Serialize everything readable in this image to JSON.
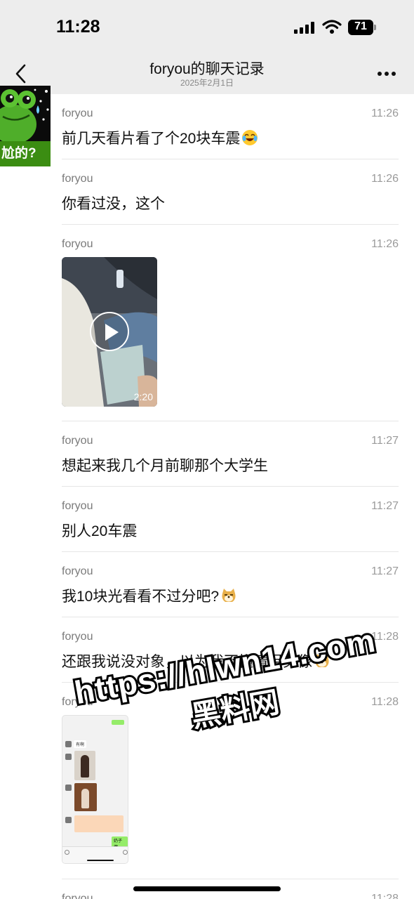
{
  "status_bar": {
    "time": "11:28",
    "battery": "71"
  },
  "nav": {
    "title": "foryou的聊天记录",
    "subtitle": "2025年2月1日"
  },
  "sticker": {
    "caption": "尬的?"
  },
  "messages": [
    {
      "sender": "foryou",
      "time": "11:26",
      "text": "前几天看片看了个20块车震",
      "emoji": "laughing-crying-emoji"
    },
    {
      "sender": "foryou",
      "time": "11:26",
      "text": "你看过没，这个"
    },
    {
      "sender": "foryou",
      "time": "11:26",
      "type": "video",
      "duration": "2:20"
    },
    {
      "sender": "foryou",
      "time": "11:27",
      "text": "想起来我几个月前聊那个大学生"
    },
    {
      "sender": "foryou",
      "time": "11:27",
      "text": "别人20车震"
    },
    {
      "sender": "foryou",
      "time": "11:27",
      "text": "我10块光看看不过分吧?",
      "emoji": "doge-emoji"
    },
    {
      "sender": "foryou",
      "time": "11:28",
      "text": "还跟我说没对象，以为我不懂情侣头像",
      "emoji": "doge-emoji"
    },
    {
      "sender": "foryou",
      "time": "11:28",
      "type": "image",
      "mini": {
        "label_1": "有啊",
        "label_2": "奶子擦"
      }
    },
    {
      "sender": "foryou",
      "time": "11:28"
    }
  ],
  "watermark": {
    "url": "https://hlwn14.com",
    "name": "黑料网"
  },
  "colors": {
    "bar_bg": "#ededed",
    "wechat_green": "#95ec69",
    "divider": "#e6e6e6"
  }
}
